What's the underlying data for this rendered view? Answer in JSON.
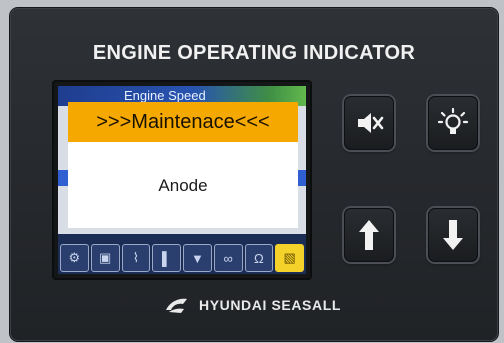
{
  "panel": {
    "title": "ENGINE OPERATING INDICATOR"
  },
  "screen": {
    "header_label": "Engine Speed",
    "popup": {
      "title": ">>>Maintenace<<<",
      "message": "Anode"
    },
    "status_icons": [
      {
        "icon": "engine-icon",
        "glyph": "⚙",
        "active": false
      },
      {
        "icon": "battery-icon",
        "glyph": "▣",
        "active": false
      },
      {
        "icon": "oil-icon",
        "glyph": "⌇",
        "active": false
      },
      {
        "icon": "temperature-icon",
        "glyph": "▌",
        "active": false
      },
      {
        "icon": "filter-icon",
        "glyph": "▼",
        "active": false
      },
      {
        "icon": "glow-plug-icon",
        "glyph": "∞",
        "active": false
      },
      {
        "icon": "alarm-icon",
        "glyph": "Ω",
        "active": false
      },
      {
        "icon": "maintenance-warning-icon",
        "glyph": "▧",
        "active": true
      }
    ]
  },
  "buttons": [
    {
      "name": "mute-button",
      "icon": "mute-icon"
    },
    {
      "name": "backlight-button",
      "icon": "light-bulb-icon"
    },
    {
      "name": "up-button",
      "icon": "arrow-up-icon"
    },
    {
      "name": "down-button",
      "icon": "arrow-down-icon"
    }
  ],
  "brand": {
    "name": "HYUNDAI SEASALL",
    "logo_icon": "hyundai-seasall-logo-icon"
  },
  "colors": {
    "popup_header": "#f5a800",
    "panel_bg": "#26292d",
    "warning_icon": "#f4d22a"
  }
}
